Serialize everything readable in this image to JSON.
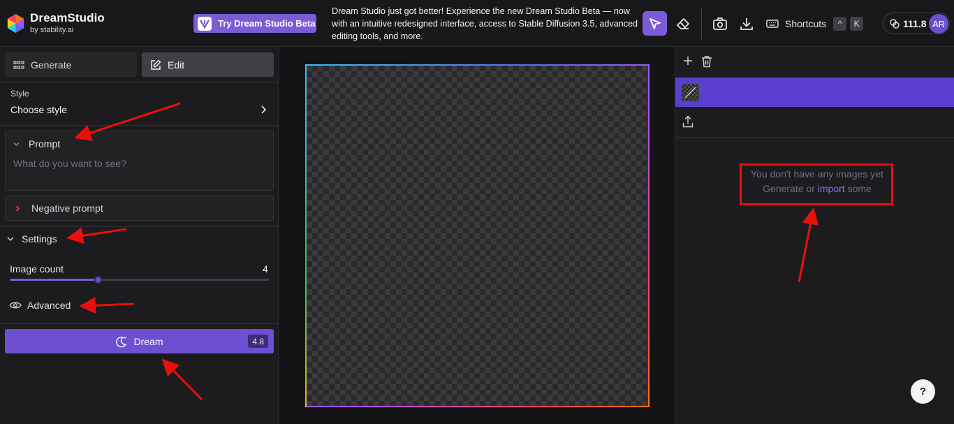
{
  "app": {
    "brand_name": "DreamStudio",
    "brand_sub": "by stability.ai"
  },
  "header": {
    "beta_button": "Try Dream Studio Beta",
    "announcement": "Dream Studio just got better! Experience the new Dream Studio Beta — now with an intuitive redesigned interface, access to Stable Diffusion 3.5, advanced editing tools, and more.",
    "shortcuts_label": "Shortcuts",
    "shortcut_keys": [
      "^",
      "K"
    ],
    "credits": "111.8",
    "avatar_initials": "AR",
    "icons": [
      "pointer-icon",
      "eraser-icon",
      "camera-icon",
      "download-icon",
      "keyboard-icon",
      "credits-icon"
    ]
  },
  "left_panel": {
    "tabs": [
      {
        "label": "Generate",
        "icon": "grid-icon",
        "active": false
      },
      {
        "label": "Edit",
        "icon": "edit-icon",
        "active": true
      }
    ],
    "style": {
      "label": "Style",
      "value": "Choose style"
    },
    "prompt": {
      "title": "Prompt",
      "placeholder": "What do you want to see?"
    },
    "negative_prompt": {
      "title": "Negative prompt"
    },
    "settings": {
      "title": "Settings",
      "image_count_label": "Image count",
      "image_count_value": "4",
      "image_count_fraction": 0.34,
      "advanced_label": "Advanced"
    },
    "dream_button": {
      "label": "Dream",
      "cost": "4.8"
    }
  },
  "right_panel": {
    "empty_line1": "You don't have any images yet",
    "empty_prefix": "Generate or ",
    "empty_link": "import",
    "empty_suffix": " some",
    "help": "?"
  },
  "colors": {
    "accent": "#6d4fd1",
    "annotation": "#e8100f"
  }
}
